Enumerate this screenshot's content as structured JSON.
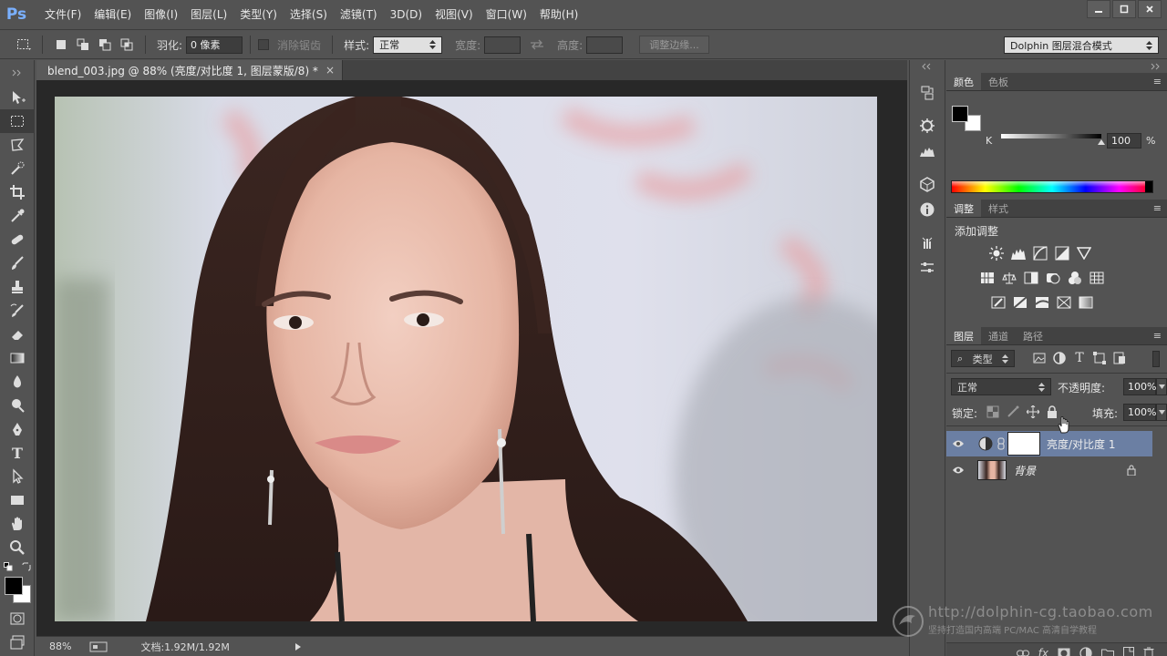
{
  "app": {
    "logo": "Ps"
  },
  "menu": [
    "文件(F)",
    "编辑(E)",
    "图像(I)",
    "图层(L)",
    "类型(Y)",
    "选择(S)",
    "滤镜(T)",
    "3D(D)",
    "视图(V)",
    "窗口(W)",
    "帮助(H)"
  ],
  "options": {
    "feather_label": "羽化:",
    "feather_value": "0 像素",
    "antialias_label": "消除锯齿",
    "style_label": "样式:",
    "style_value": "正常",
    "width_label": "宽度:",
    "height_label": "高度:",
    "refine_edge": "调整边缘...",
    "workspace": "Dolphin 图层混合模式"
  },
  "document": {
    "tab_title": "blend_003.jpg @ 88% (亮度/对比度 1, 图层蒙版/8) *",
    "close": "×"
  },
  "status": {
    "zoom": "88%",
    "doc_info": "文档:1.92M/1.92M"
  },
  "color_panel": {
    "tabs": [
      "颜色",
      "色板"
    ],
    "channel_label": "K",
    "channel_value": "100",
    "unit": "%"
  },
  "adjust_panel": {
    "tabs": [
      "调整",
      "样式"
    ],
    "title": "添加调整"
  },
  "layers_panel": {
    "tabs": [
      "图层",
      "通道",
      "路径"
    ],
    "filter": "类型",
    "blend_mode": "正常",
    "opacity_label": "不透明度:",
    "opacity_value": "100%",
    "lock_label": "锁定:",
    "fill_label": "填充:",
    "fill_value": "100%",
    "layers": [
      {
        "name": "亮度/对比度 1",
        "selected": true
      },
      {
        "name": "背景",
        "selected": false
      }
    ]
  },
  "watermark": {
    "url": "http://dolphin-cg.taobao.com",
    "tagline": "坚持打造国内高端 PC/MAC 高清自学教程"
  },
  "colors": {
    "accent": "#7ab0ff",
    "selected_layer": "#6b7fa3"
  }
}
